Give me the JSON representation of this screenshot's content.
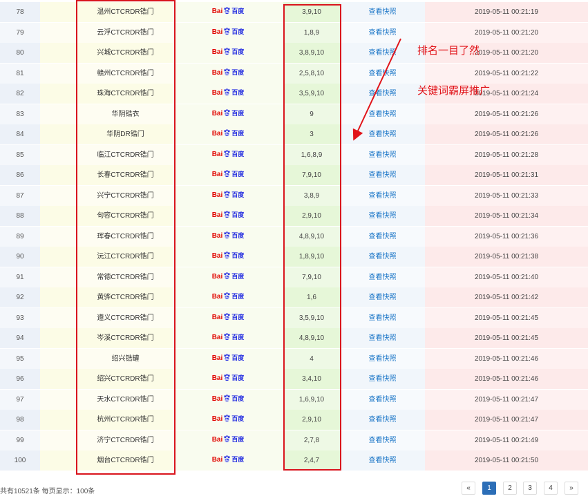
{
  "rows": [
    {
      "num": "78",
      "keyword": "温州CTCRDR锆门",
      "rank": "3,9,10",
      "snapshot": "查看快照",
      "time": "2019-05-11 00:21:19"
    },
    {
      "num": "79",
      "keyword": "云浮CTCRDR锆门",
      "rank": "1,8,9",
      "snapshot": "查看快照",
      "time": "2019-05-11 00:21:20"
    },
    {
      "num": "80",
      "keyword": "兴城CTCRDR锆门",
      "rank": "3,8,9,10",
      "snapshot": "查看快照",
      "time": "2019-05-11 00:21:20"
    },
    {
      "num": "81",
      "keyword": "赣州CTCRDR锆门",
      "rank": "2,5,8,10",
      "snapshot": "查看快照",
      "time": "2019-05-11 00:21:22"
    },
    {
      "num": "82",
      "keyword": "珠海CTCRDR锆门",
      "rank": "3,5,9,10",
      "snapshot": "查看快照",
      "time": "2019-05-11 00:21:24"
    },
    {
      "num": "83",
      "keyword": "华阴锆衣",
      "rank": "9",
      "snapshot": "查看快照",
      "time": "2019-05-11 00:21:26"
    },
    {
      "num": "84",
      "keyword": "华阴DR锆门",
      "rank": "3",
      "snapshot": "查看快照",
      "time": "2019-05-11 00:21:26"
    },
    {
      "num": "85",
      "keyword": "临江CTCRDR锆门",
      "rank": "1,6,8,9",
      "snapshot": "查看快照",
      "time": "2019-05-11 00:21:28"
    },
    {
      "num": "86",
      "keyword": "长春CTCRDR锆门",
      "rank": "7,9,10",
      "snapshot": "查看快照",
      "time": "2019-05-11 00:21:31"
    },
    {
      "num": "87",
      "keyword": "兴宁CTCRDR锆门",
      "rank": "3,8,9",
      "snapshot": "查看快照",
      "time": "2019-05-11 00:21:33"
    },
    {
      "num": "88",
      "keyword": "句容CTCRDR锆门",
      "rank": "2,9,10",
      "snapshot": "查看快照",
      "time": "2019-05-11 00:21:34"
    },
    {
      "num": "89",
      "keyword": "珲春CTCRDR锆门",
      "rank": "4,8,9,10",
      "snapshot": "查看快照",
      "time": "2019-05-11 00:21:36"
    },
    {
      "num": "90",
      "keyword": "沅江CTCRDR锆门",
      "rank": "1,8,9,10",
      "snapshot": "查看快照",
      "time": "2019-05-11 00:21:38"
    },
    {
      "num": "91",
      "keyword": "常德CTCRDR锆门",
      "rank": "7,9,10",
      "snapshot": "查看快照",
      "time": "2019-05-11 00:21:40"
    },
    {
      "num": "92",
      "keyword": "黄骅CTCRDR锆门",
      "rank": "1,6",
      "snapshot": "查看快照",
      "time": "2019-05-11 00:21:42"
    },
    {
      "num": "93",
      "keyword": "遵义CTCRDR锆门",
      "rank": "3,5,9,10",
      "snapshot": "查看快照",
      "time": "2019-05-11 00:21:45"
    },
    {
      "num": "94",
      "keyword": "岑溪CTCRDR锆门",
      "rank": "4,8,9,10",
      "snapshot": "查看快照",
      "time": "2019-05-11 00:21:45"
    },
    {
      "num": "95",
      "keyword": "绍兴锆罐",
      "rank": "4",
      "snapshot": "查看快照",
      "time": "2019-05-11 00:21:46"
    },
    {
      "num": "96",
      "keyword": "绍兴CTCRDR锆门",
      "rank": "3,4,10",
      "snapshot": "查看快照",
      "time": "2019-05-11 00:21:46"
    },
    {
      "num": "97",
      "keyword": "天水CTCRDR锆门",
      "rank": "1,6,9,10",
      "snapshot": "查看快照",
      "time": "2019-05-11 00:21:47"
    },
    {
      "num": "98",
      "keyword": "杭州CTCRDR锆门",
      "rank": "2,9,10",
      "snapshot": "查看快照",
      "time": "2019-05-11 00:21:47"
    },
    {
      "num": "99",
      "keyword": "济宁CTCRDR锆门",
      "rank": "2,7,8",
      "snapshot": "查看快照",
      "time": "2019-05-11 00:21:49"
    },
    {
      "num": "100",
      "keyword": "烟台CTCRDR锆门",
      "rank": "2,4,7",
      "snapshot": "查看快照",
      "time": "2019-05-11 00:21:50"
    }
  ],
  "engine_logo": {
    "icon": "baidu-logo",
    "text_left": "Bai",
    "text_right": "百度"
  },
  "annotations": {
    "line1": "排名一目了然",
    "line2": "关键词霸屏推广",
    "color": "#e1141a"
  },
  "footer": {
    "summary": "共有10521条 每页显示：100条"
  },
  "pagination": {
    "prev": "«",
    "pages": [
      "1",
      "2",
      "3",
      "4"
    ],
    "current": "1",
    "next": "»",
    "active_color": "#2c6eb7"
  },
  "colors": {
    "highlight_box": "#d9141c",
    "link": "#1a75c7"
  }
}
